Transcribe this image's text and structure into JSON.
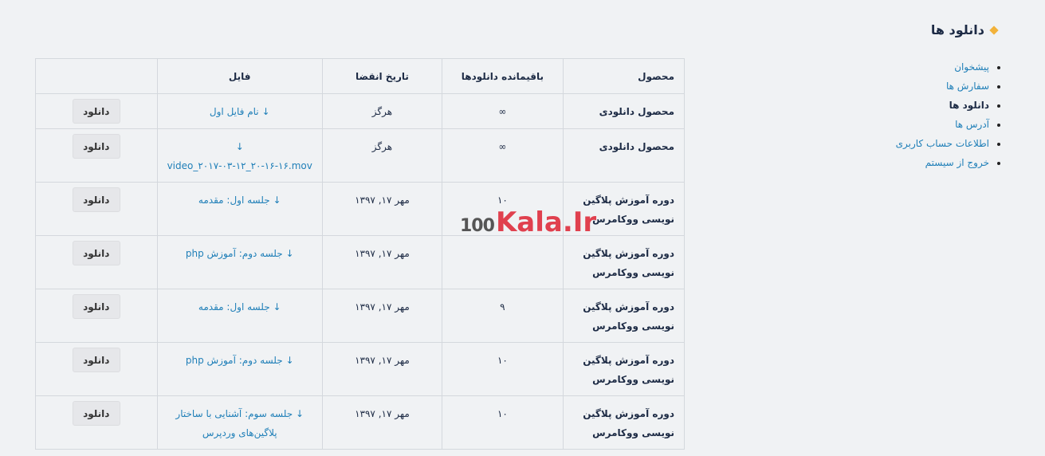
{
  "section": {
    "title": "دانلود ها"
  },
  "nav": {
    "items": [
      {
        "label": "پیشخوان",
        "active": false
      },
      {
        "label": "سفارش ها",
        "active": false
      },
      {
        "label": "دانلود ها",
        "active": true
      },
      {
        "label": "آدرس ها",
        "active": false
      },
      {
        "label": "اطلاعات حساب کاربری",
        "active": false
      },
      {
        "label": "خروج از سیستم",
        "active": false
      }
    ]
  },
  "table": {
    "headers": {
      "product": "محصول",
      "remaining": "باقیمانده دانلودها",
      "expires": "تاریخ انقضا",
      "file": "فایل",
      "action": ""
    },
    "rows": [
      {
        "product": "محصول دانلودی",
        "remaining": "∞",
        "expires": "هرگز",
        "file": "↓ نام فایل اول",
        "action": "دانلود"
      },
      {
        "product": "محصول دانلودی",
        "remaining": "∞",
        "expires": "هرگز",
        "file": "↓ video_۲۰۱۷-۰۳-۱۲_۲۰-۱۶-۱۶.mov",
        "action": "دانلود"
      },
      {
        "product": "دوره آموزش پلاگین نویسی ووکامرس",
        "remaining": "۱۰",
        "expires": "مهر ۱۷, ۱۳۹۷",
        "file": "↓ جلسه اول: مقدمه",
        "action": "دانلود"
      },
      {
        "product": "دوره آموزش پلاگین نویسی ووکامرس",
        "remaining": "",
        "expires": "مهر ۱۷, ۱۳۹۷",
        "file": "↓ جلسه دوم: آموزش php",
        "action": "دانلود"
      },
      {
        "product": "دوره آموزش پلاگین نویسی ووکامرس",
        "remaining": "۹",
        "expires": "مهر ۱۷, ۱۳۹۷",
        "file": "↓ جلسه اول: مقدمه",
        "action": "دانلود"
      },
      {
        "product": "دوره آموزش پلاگین نویسی ووکامرس",
        "remaining": "۱۰",
        "expires": "مهر ۱۷, ۱۳۹۷",
        "file": "↓ جلسه دوم: آموزش php",
        "action": "دانلود"
      },
      {
        "product": "دوره آموزش پلاگین نویسی ووکامرس",
        "remaining": "۱۰",
        "expires": "مهر ۱۷, ۱۳۹۷",
        "file": "↓ جلسه سوم: آشنایی با ساختار پلاگین‌های وردپرس",
        "action": "دانلود"
      }
    ]
  },
  "watermark": {
    "number": "100",
    "brand": "Kala.Ir"
  },
  "colors": {
    "accent": "#f2b23a",
    "link": "#1f7fb8",
    "text": "#1d2b45",
    "watermark": "#e0404e"
  },
  "icons": {
    "title_marker": "diamond-icon",
    "file_link": "download-arrow-icon"
  }
}
